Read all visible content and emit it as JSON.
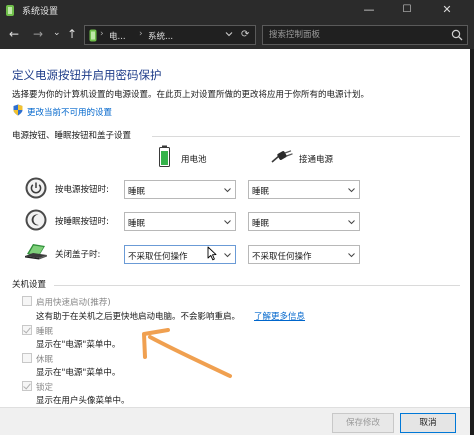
{
  "window": {
    "title": "系统设置",
    "minimize": "—",
    "maximize": "☐",
    "close": "✕"
  },
  "nav": {
    "back": "←",
    "forward": "→",
    "recent": "⌄",
    "up": "↑",
    "breadcrumb": [
      "电...",
      "系统..."
    ],
    "breadcrumb_sep": "›",
    "search_placeholder": "搜索控制面板"
  },
  "header": {
    "title": "定义电源按钮并启用密码保护",
    "description": "选择要为你的计算机设置的电源设置。在此页上对设置所做的更改将应用于你所有的电源计划。",
    "change_link": "更改当前不可用的设置"
  },
  "power_section": {
    "heading": "电源按钮、睡眠按钮和盖子设置",
    "columns": [
      "用电池",
      "接通电源"
    ],
    "rows": [
      {
        "label": "按电源按钮时:",
        "battery": "睡眠",
        "plugged": "睡眠"
      },
      {
        "label": "按睡眠按钮时:",
        "battery": "睡眠",
        "plugged": "睡眠"
      },
      {
        "label": "关闭盖子时:",
        "battery": "不采取任何操作",
        "plugged": "不采取任何操作"
      }
    ]
  },
  "shutdown_section": {
    "heading": "关机设置",
    "items": [
      {
        "label": "启用快速启动(推荐)",
        "checked": false,
        "desc": "这有助于在关机之后更快地启动电脑。不会影响重启。",
        "link": "了解更多信息"
      },
      {
        "label": "睡眠",
        "checked": true,
        "desc": "显示在\"电源\"菜单中。"
      },
      {
        "label": "休眠",
        "checked": false,
        "desc": "显示在\"电源\"菜单中。"
      },
      {
        "label": "锁定",
        "checked": true,
        "desc": "显示在用户头像菜单中。"
      }
    ]
  },
  "footer": {
    "save": "保存修改",
    "cancel": "取消"
  },
  "colors": {
    "title": "#1f3d8a",
    "link": "#0066cc",
    "annotation": "#f0a050"
  }
}
